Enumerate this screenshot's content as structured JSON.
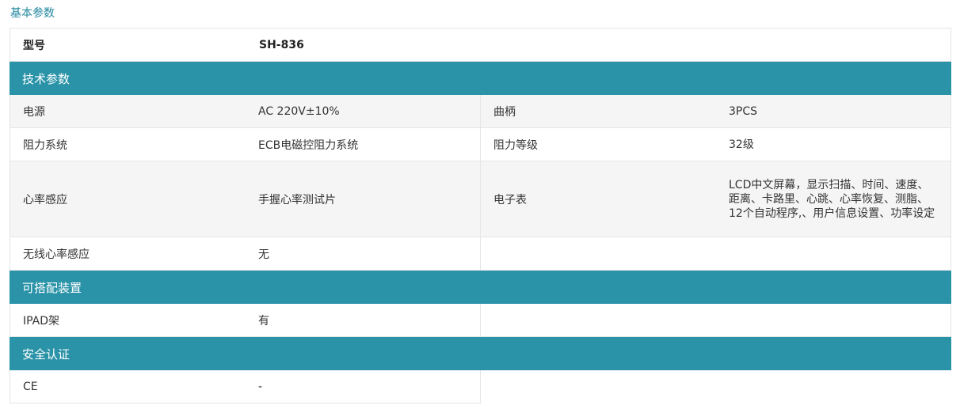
{
  "page_title": "基本参数",
  "model": {
    "label": "型号",
    "value": "SH-836"
  },
  "sections": {
    "tech": "技术参数",
    "accessories": "可搭配装置",
    "certification": "安全认证"
  },
  "tech_rows": [
    {
      "k1": "电源",
      "v1": "AC 220V±10%",
      "k2": "曲柄",
      "v2": "3PCS"
    },
    {
      "k1": "阻力系统",
      "v1": "ECB电磁控阻力系统",
      "k2": "阻力等级",
      "v2": "32级"
    },
    {
      "k1": "心率感应",
      "v1": "手握心率测试片",
      "k2": "电子表",
      "v2": "LCD中文屏幕，显示扫描、时间、速度、距离、卡路里、心跳、心率恢复、测脂、12个自动程序,、用户信息设置、功率设定"
    },
    {
      "k1": "无线心率感应",
      "v1": "无",
      "k2": "",
      "v2": ""
    }
  ],
  "accessory_rows": [
    {
      "k1": "IPAD架",
      "v1": "有"
    }
  ],
  "cert_rows": [
    {
      "k1": "CE",
      "v1": "-"
    }
  ]
}
